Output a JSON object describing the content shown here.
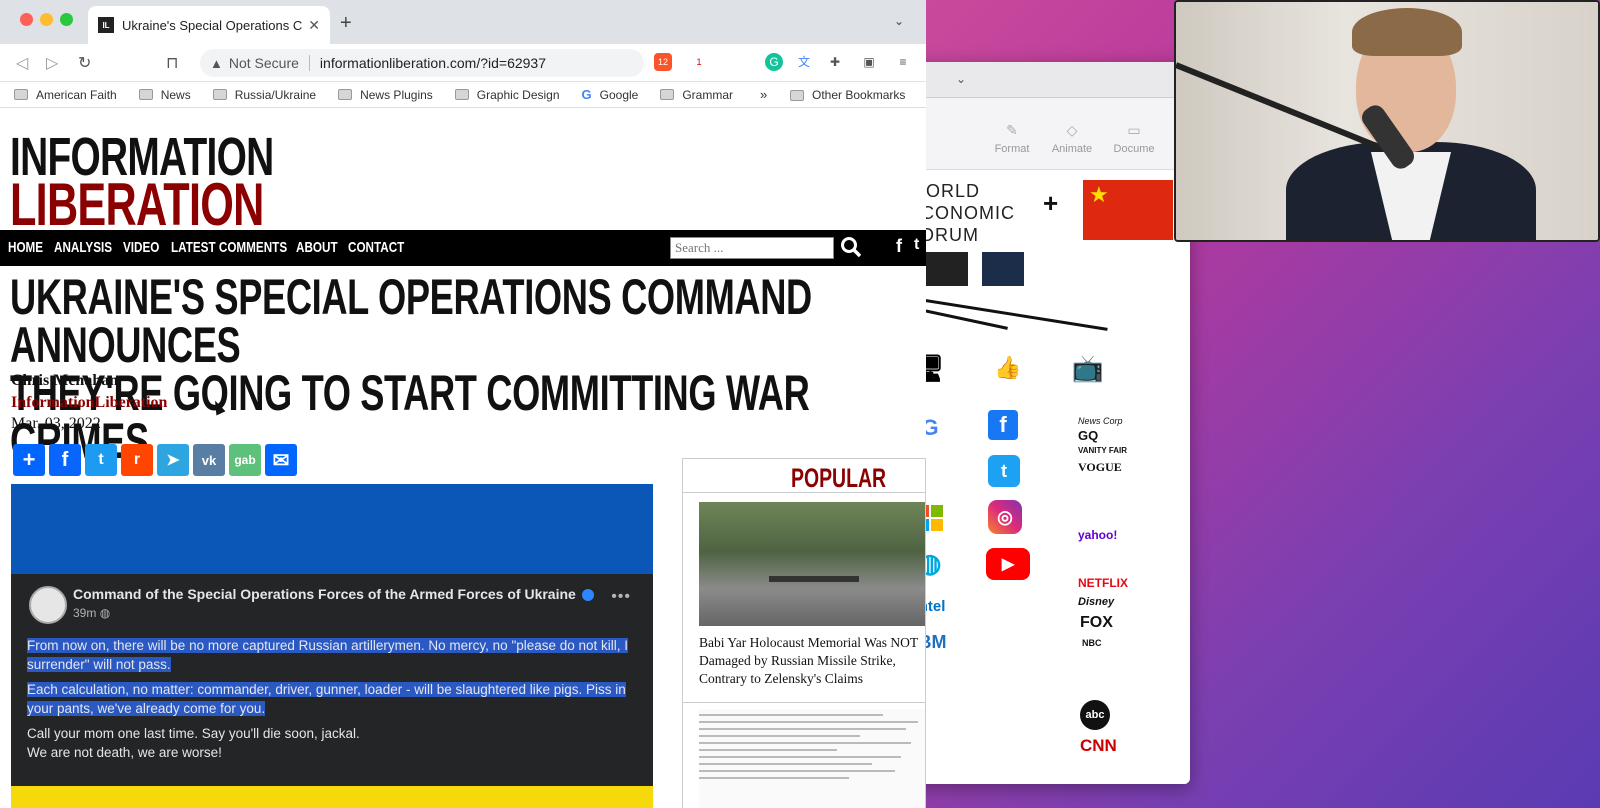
{
  "browser": {
    "tab_title": "Ukraine's Special Operations C",
    "favicon_text": "IL",
    "address": {
      "warning": "Not Secure",
      "url": "informationliberation.com/?id=62937"
    },
    "extensions": {
      "brave_count": "12",
      "alert_count": "1"
    },
    "bookmarks": [
      "American Faith",
      "News",
      "Russia/Ukraine",
      "News Plugins",
      "Graphic Design",
      "Google",
      "Grammar"
    ],
    "more_bookmarks": "»",
    "other_bookmarks": "Other Bookmarks"
  },
  "site": {
    "logo_line1": "INFORMATION",
    "logo_line2": "LIBERATION",
    "nav": [
      "HOME",
      "ANALYSIS",
      "VIDEO",
      "LATEST COMMENTS",
      "ABOUT",
      "CONTACT"
    ],
    "search_placeholder": "Search ..."
  },
  "article": {
    "headline_line1": "UKRAINE'S SPECIAL OPERATIONS COMMAND ANNOUNCES",
    "headline_line2": "THEY'RE GOING TO START COMMITTING WAR CRIMES",
    "author": "Chris Menahan",
    "source": "InformationLiberation",
    "date": "Mar. 03, 2022",
    "share_icons": [
      "add-icon",
      "facebook-icon",
      "twitter-icon",
      "reddit-icon",
      "telegram-icon",
      "vk-icon",
      "gab-icon",
      "email-icon"
    ],
    "share_glyphs": [
      "+",
      "f",
      "t",
      "r",
      "➤",
      "vk",
      "gab",
      "✉"
    ],
    "post": {
      "name": "Command of the Special Operations Forces of the Armed Forces of Ukraine",
      "time": "39m",
      "more": "•••",
      "p1": "From now on, there will be no more captured Russian artillerymen. No mercy, no \"please do not kill, I surrender\" will not pass.",
      "p2": "Each calculation, no matter: commander, driver, gunner, loader - will be slaughtered like pigs. Piss in your pants, we've already come for you.",
      "p3": "Call your mom one last time. Say you'll die soon, jackal.",
      "p4": "We are not death, we are worse!"
    }
  },
  "popular": {
    "title": "POPULAR",
    "item1": "Babi Yar Holocaust Memorial Was NOT Damaged by Russian Missile Strike, Contrary to Zelensky's Claims"
  },
  "back_app": {
    "tools": [
      "Format",
      "Animate",
      "Docume"
    ],
    "wef_text": "WORLD\nECONOMIC\nFORUM",
    "plus": "+",
    "brands_right": [
      "News Corp",
      "GQ",
      "VANITY FAIR",
      "VOGUE",
      "yahoo!",
      "NETFLIX",
      "Disney",
      "FOX",
      "NBC",
      "abc",
      "CNN"
    ],
    "left_glyphs": [
      "G",
      "",
      "IBM",
      "intel"
    ]
  },
  "colors": {
    "logo_red": "#8b0000",
    "nav_black": "#000000",
    "fb_dark": "#242526",
    "highlight": "#2b59c3",
    "ukraine_blue": "#0b57b7",
    "ukraine_yellow": "#f5d90a"
  }
}
